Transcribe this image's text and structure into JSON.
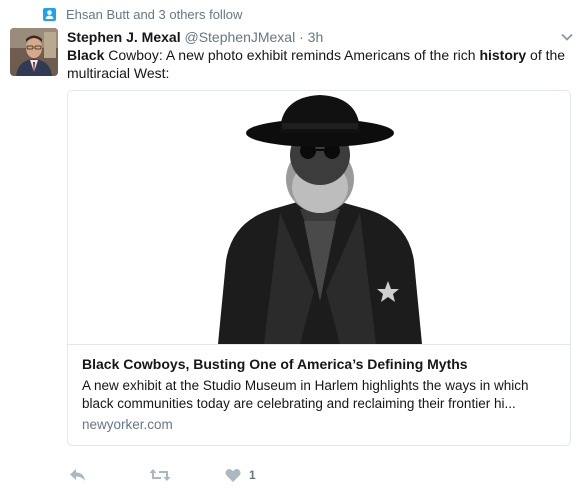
{
  "context": {
    "icon": "person-follow-icon",
    "text": "Ehsan Butt and 3 others follow"
  },
  "tweet": {
    "name": "Stephen J. Mexal",
    "handle": "@StephenJMexal",
    "separator": "·",
    "time": "3h",
    "text_parts": [
      "Black",
      " Cowboy: A new photo exhibit reminds Americans of the rich ",
      "history",
      " of the multiracial West:"
    ]
  },
  "card": {
    "title": "Black Cowboys, Busting One of America’s Defining Myths",
    "description": "A new exhibit at the Studio Museum in Harlem highlights the ways in which black communities today are celebrating and reclaiming their frontier hi...",
    "domain": "newyorker.com"
  },
  "actions": {
    "reply_icon": "reply-icon",
    "retweet_icon": "retweet-icon",
    "like_icon": "heart-icon",
    "like_count": "1"
  },
  "colors": {
    "accent": "#1da1f2",
    "muted": "#657786",
    "action_gray": "#aab8c2",
    "border": "#e1e8ed"
  }
}
